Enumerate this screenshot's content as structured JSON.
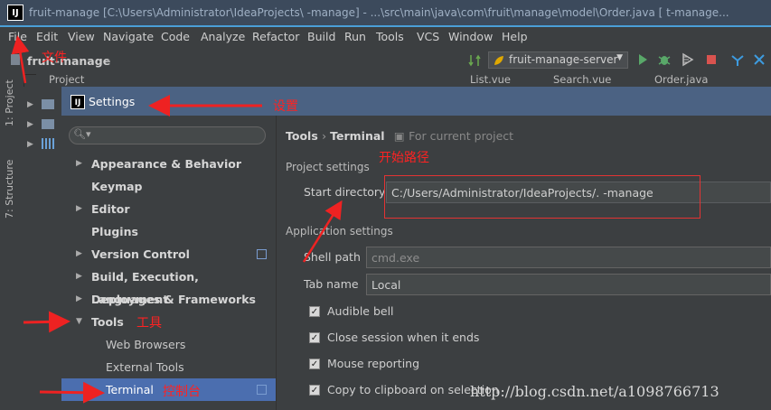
{
  "window": {
    "title": "fruit-manage [C:\\Users\\Administrator\\IdeaProjects\\   -manage] - ...\\src\\main\\java\\com\\fruit\\manage\\model\\Order.java [   t-manage..."
  },
  "menu": [
    "File",
    "Edit",
    "View",
    "Navigate",
    "Code",
    "Analyze",
    "Refactor",
    "Build",
    "Run",
    "Tools",
    "VCS",
    "Window",
    "Help"
  ],
  "toolbar": {
    "project_name": "fruit-manage",
    "run_config": "fruit-manage-server"
  },
  "tabs": [
    "Project",
    "List.vue",
    "Search.vue",
    "Order.java"
  ],
  "left_tabs": [
    "1: Project",
    "7: Structure"
  ],
  "dialog": {
    "title": "Settings",
    "breadcrumb_root": "Tools",
    "breadcrumb_leaf": "Terminal",
    "scope": "For current project"
  },
  "sidebar": [
    {
      "label": "Appearance & Behavior",
      "arrow": "▶",
      "level": 0
    },
    {
      "label": "Keymap",
      "arrow": "",
      "level": 0
    },
    {
      "label": "Editor",
      "arrow": "▶",
      "level": 0
    },
    {
      "label": "Plugins",
      "arrow": "",
      "level": 0
    },
    {
      "label": "Version Control",
      "arrow": "▶",
      "level": 0,
      "copy": true
    },
    {
      "label": "Build, Execution, Deployment",
      "arrow": "▶",
      "level": 0
    },
    {
      "label": "Languages & Frameworks",
      "arrow": "▶",
      "level": 0
    },
    {
      "label": "Tools",
      "arrow": "▼",
      "level": 0
    },
    {
      "label": "Web Browsers",
      "arrow": "",
      "level": 1
    },
    {
      "label": "External Tools",
      "arrow": "",
      "level": 1
    },
    {
      "label": "Terminal",
      "arrow": "",
      "level": 1,
      "selected": true,
      "copy": true
    }
  ],
  "content": {
    "project_settings": "Project settings",
    "start_directory_label": "Start directory",
    "start_directory_value": "C:/Users/Administrator/IdeaProjects/.       -manage",
    "application_settings": "Application settings",
    "shell_path_label": "Shell path",
    "shell_path_value": "cmd.exe",
    "tab_name_label": "Tab name",
    "tab_name_value": "Local",
    "checkboxes": [
      {
        "label": "Audible bell",
        "checked": true
      },
      {
        "label": "Close session when it ends",
        "checked": true
      },
      {
        "label": "Mouse reporting",
        "checked": true
      },
      {
        "label": "Copy to clipboard on selection",
        "checked": true
      }
    ]
  },
  "annotations": {
    "file": "文件",
    "settings": "设置",
    "start_path": "开始路径",
    "tools": "工具",
    "console": "控制台"
  },
  "watermark": "http://blog.csdn.net/a1098766713",
  "colors": {
    "accent": "#4b6eaf",
    "annotation": "#ff2222",
    "dialog_title": "#4b6283"
  }
}
